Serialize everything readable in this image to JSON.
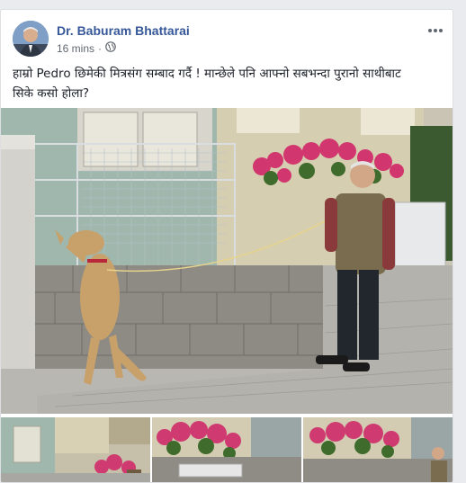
{
  "post": {
    "author": "Dr. Baburam Bhattarai",
    "timestamp": "16 mins",
    "separator": "·",
    "privacy_icon": "globe-icon",
    "menu_icon": "more-dots-icon",
    "text_line1": "हाम्रो Pedro छिमेकी मित्रसंग सम्बाद गर्दै ! मान्छेले पनि आफ्नो सबभन्दा पुरानो साथीबाट",
    "text_line2": "सिके कसो होला?"
  },
  "colors": {
    "author_link": "#365899",
    "meta_text": "#616770",
    "post_text": "#1d2129",
    "card_bg": "#ffffff",
    "page_bg": "#e9ebee"
  }
}
